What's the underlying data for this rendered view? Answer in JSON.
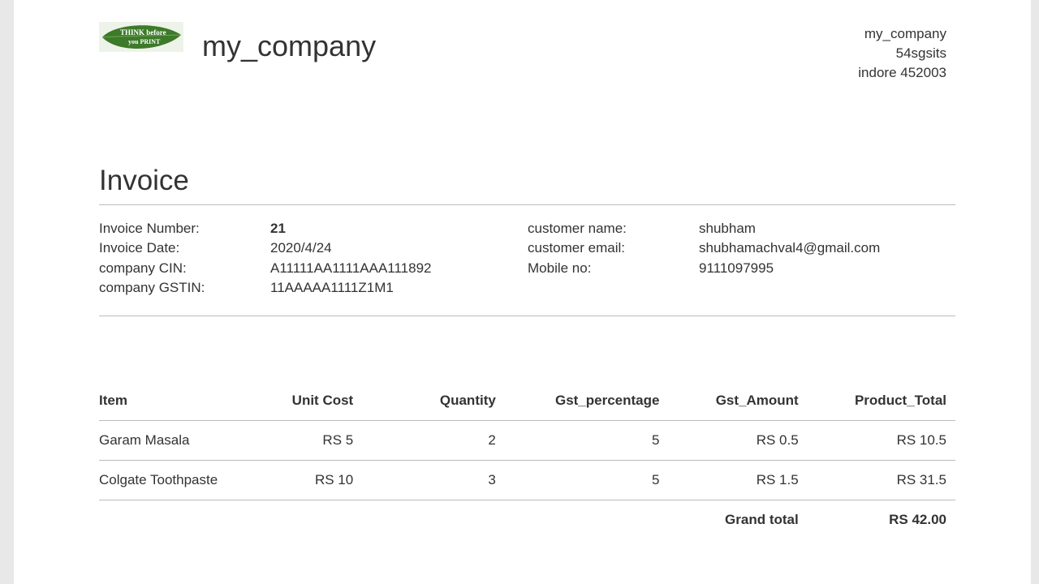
{
  "header": {
    "company_name": "my_company",
    "logo_text_line1": "THINK before",
    "logo_text_line2": "you PRINT",
    "address_lines": [
      "my_company",
      "54sgsits",
      "indore 452003"
    ]
  },
  "invoice": {
    "heading": "Invoice",
    "left_fields": [
      {
        "label": "Invoice Number:",
        "value": "21"
      },
      {
        "label": "Invoice Date:",
        "value": "2020/4/24"
      },
      {
        "label": "company CIN:",
        "value": "A11111AA1111AAA111892"
      },
      {
        "label": "company GSTIN:",
        "value": "11AAAAA1111Z1M1"
      }
    ],
    "right_fields": [
      {
        "label": "customer name:",
        "value": "shubham"
      },
      {
        "label": "customer email:",
        "value": "shubhamachval4@gmail.com"
      },
      {
        "label": "Mobile no:",
        "value": "9111097995"
      }
    ]
  },
  "table": {
    "columns": [
      "Item",
      "Unit Cost",
      "Quantity",
      "Gst_percentage",
      "Gst_Amount",
      "Product_Total"
    ],
    "rows": [
      [
        "Garam Masala",
        "RS 5",
        "2",
        "5",
        "RS 0.5",
        "RS 10.5"
      ],
      [
        "Colgate Toothpaste",
        "RS 10",
        "3",
        "5",
        "RS 1.5",
        "RS 31.5"
      ]
    ],
    "grand_total_label": "Grand total",
    "grand_total_value": "RS 42.00"
  },
  "colors": {
    "logo_green": "#3d7a2a",
    "rule": "#bbbbbb",
    "text": "#333333"
  }
}
